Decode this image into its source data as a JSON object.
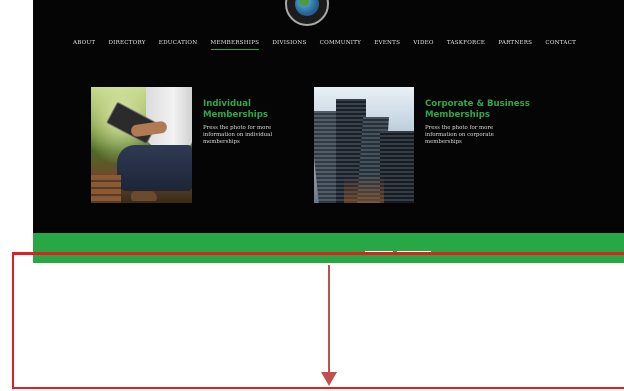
{
  "nav": {
    "items": [
      {
        "label": "ABOUT"
      },
      {
        "label": "DIRECTORY"
      },
      {
        "label": "EDUCATION"
      },
      {
        "label": "MEMBERSHIPS",
        "active": true
      },
      {
        "label": "DIVISIONS"
      },
      {
        "label": "COMMUNITY"
      },
      {
        "label": "EVENTS"
      },
      {
        "label": "VIDEO"
      },
      {
        "label": "TASKFORCE"
      },
      {
        "label": "PARTNERS"
      },
      {
        "label": "CONTACT"
      }
    ]
  },
  "memberships": {
    "individual": {
      "title": "Individual Memberships",
      "description": "Press the photo for more information on individual memberships"
    },
    "corporate": {
      "title": "Corporate & Business Memberships",
      "description": "Press the photo for more information on corporate memberships"
    }
  },
  "colors": {
    "background": "#050505",
    "accent_green": "#28a745",
    "title_green": "#2fa84b",
    "annotation_red": "#e02020",
    "arrow": "#c0504d"
  },
  "icons": {
    "logo": "globe-seal-icon",
    "arrow": "arrow-down-icon"
  }
}
